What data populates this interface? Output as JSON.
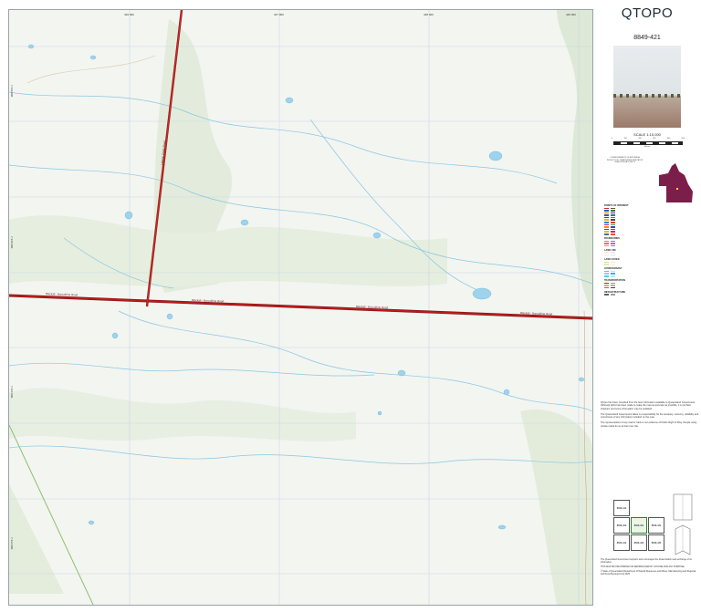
{
  "title": "QTOPO",
  "sheet_number": "8849-421",
  "scale": "SCALE 1:10,000",
  "scalebar_ticks": [
    "0",
    "100",
    "200",
    "300",
    "400",
    "500"
  ],
  "scalebar_unit": "Metres",
  "inset_caption": [
    "COMMONWEALTH OF AUSTRALIA",
    "PROJECTION: TRANSVERSE MERCATOR",
    "GDA2020 MGA ZONE 55"
  ],
  "legend": {
    "points_of_interest": "POINTS OF INTEREST",
    "boundaries": "BOUNDARIES",
    "land_use": "LAND USE",
    "land_cover": "LAND COVER",
    "hydrography": "HYDROGRAPHY",
    "transportation": "TRANSPORTATION",
    "infrastructure": "INFRASTRUCTURE"
  },
  "map": {
    "road_labels": [
      "Blackall - Barcaldine Road",
      "Blackall - Barcaldine Road",
      "Blackall - Barcaldine Road",
      "Blackall - Barcaldine Road"
    ],
    "vertical_road_label": "Lagoon Creek Road",
    "top_ticks": [
      "446 000",
      "447 000",
      "448 000",
      "449 000"
    ],
    "side_ticks": [
      "7 336 000",
      "7 335 000",
      "7 334 000",
      "7 333 000"
    ]
  },
  "disclaimer": [
    "QTopo has been compiled from the best information available to Queensland Government. Although effort has been made to make the map as accurate as possible, it is not field checked, and some information may be outdated.",
    "The Queensland Government takes no responsibility for the accuracy, currency, reliability and correctness of any information included on the map.",
    "The representation of any road or track is not evidence of Public Right of Way. People using private roads do so at their own risk."
  ],
  "index_cells": [
    "8849-412",
    "8849-422",
    "8849-413",
    "8849-421",
    "8849-431",
    "8849-414",
    "8849-424",
    "8849-434"
  ],
  "footer": [
    "The Queensland Government supports and encourages the dissemination and exchange of its information.",
    "THIS MAP MAY BE PRINTED OR REPRODUCED BY ANYONE FOR ANY PURPOSE.",
    "© State of Queensland (Department of Natural Resources and Mines, Manufacturing and Regional and Rural Development) 2025"
  ],
  "colors": {
    "road": "#b71c1c",
    "water": "#9fd3ec",
    "vegetation": "#dfe9d8",
    "creek": "#8ac6e0",
    "grid": "#c6d9e6"
  }
}
